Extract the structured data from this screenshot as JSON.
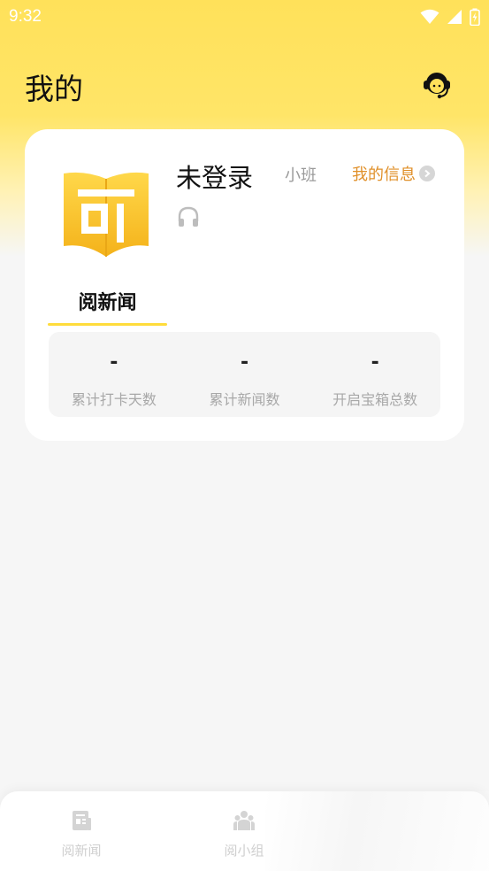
{
  "status_bar": {
    "time": "9:32",
    "icons": [
      "wifi-icon",
      "signal-icon",
      "battery-icon"
    ]
  },
  "header": {
    "title": "我的",
    "support_icon": "customer-service-icon"
  },
  "profile": {
    "name": "未登录",
    "class": "小班",
    "my_info_label": "我的信息",
    "logo_icon": "book-logo-icon",
    "audio_icon": "headphone-icon"
  },
  "tabs": [
    {
      "label": "阅新闻",
      "active": true
    }
  ],
  "stats": [
    {
      "value": "-",
      "label": "累计打卡天数"
    },
    {
      "value": "-",
      "label": "累计新闻数"
    },
    {
      "value": "-",
      "label": "开启宝箱总数"
    }
  ],
  "bottom_nav": {
    "items": [
      {
        "label": "阅新闻",
        "icon": "newspaper-icon"
      },
      {
        "label": "阅小组",
        "icon": "group-icon"
      }
    ]
  },
  "colors": {
    "brand_yellow": "#ffe15a",
    "accent_orange": "#e0902a",
    "tab_underline": "#ffdc3c"
  }
}
